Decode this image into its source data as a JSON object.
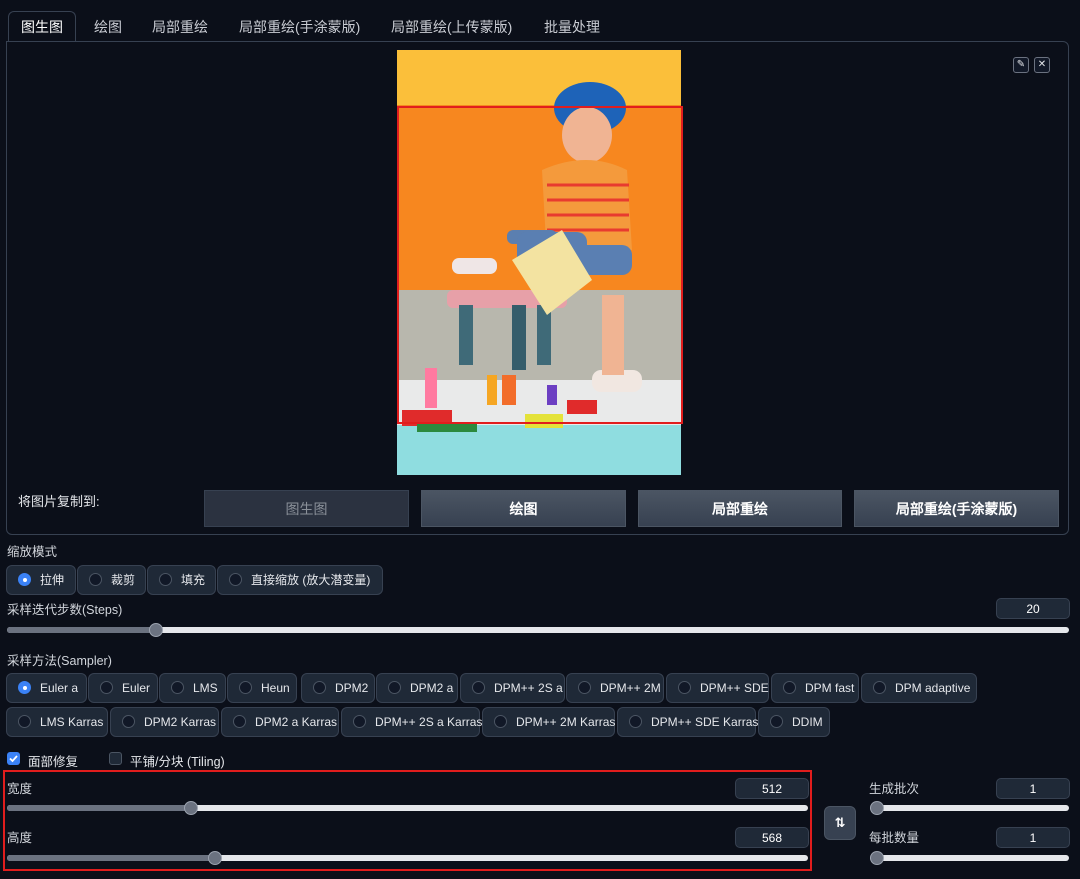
{
  "tabs": [
    "图生图",
    "绘图",
    "局部重绘",
    "局部重绘(手涂蒙版)",
    "局部重绘(上传蒙版)",
    "批量处理"
  ],
  "image": {
    "edit_icon": "pencil-icon",
    "close_icon": "close-icon"
  },
  "copy_to": {
    "label": "将图片复制到:",
    "buttons": [
      "图生图",
      "绘图",
      "局部重绘",
      "局部重绘(手涂蒙版)"
    ]
  },
  "resize_mode": {
    "label": "缩放模式",
    "options": [
      "拉伸",
      "裁剪",
      "填充",
      "直接缩放 (放大潜变量)"
    ],
    "selected": "拉伸"
  },
  "steps": {
    "label": "采样迭代步数(Steps)",
    "value": "20",
    "fraction": 0.14
  },
  "sampler": {
    "label": "采样方法(Sampler)",
    "row1": [
      "Euler a",
      "Euler",
      "LMS",
      "Heun",
      "DPM2",
      "DPM2 a",
      "DPM++ 2S a",
      "DPM++ 2M",
      "DPM++ SDE",
      "DPM fast",
      "DPM adaptive"
    ],
    "row2": [
      "LMS Karras",
      "DPM2 Karras",
      "DPM2 a Karras",
      "DPM++ 2S a Karras",
      "DPM++ 2M Karras",
      "DPM++ SDE Karras",
      "DDIM"
    ],
    "selected": "Euler a"
  },
  "options": {
    "face_restore": "面部修复",
    "face_restore_checked": true,
    "tiling": "平铺/分块 (Tiling)",
    "tiling_checked": false
  },
  "width": {
    "label": "宽度",
    "value": "512",
    "fraction": 0.23
  },
  "height": {
    "label": "高度",
    "value": "568",
    "fraction": 0.26
  },
  "batch_count": {
    "label": "生成批次",
    "value": "1",
    "fraction": 0.0
  },
  "batch_size": {
    "label": "每批数量",
    "value": "1",
    "fraction": 0.0
  },
  "swap_icon": "swap-vertical-icon",
  "colors": {
    "accent": "#3b82f6",
    "highlight_box": "#e11d1d",
    "background": "#0b0f19"
  }
}
